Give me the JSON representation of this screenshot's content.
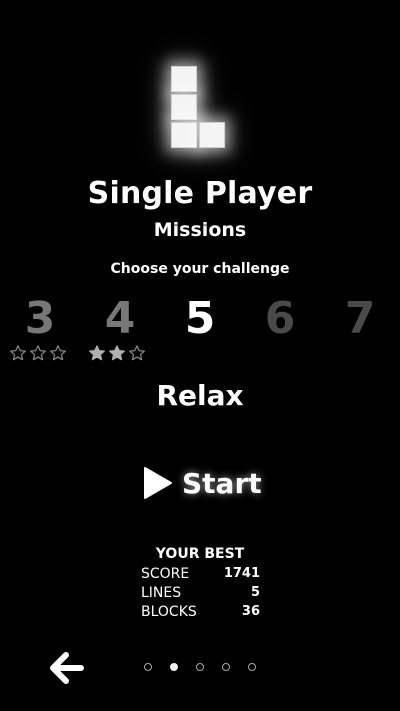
{
  "header": {
    "title": "Single Player",
    "subtitle": "Missions",
    "prompt": "Choose your challenge"
  },
  "levels": [
    {
      "label": "3",
      "state": "dim",
      "stars_earned": 0,
      "stars_total": 3
    },
    {
      "label": "4",
      "state": "dim",
      "stars_earned": 2,
      "stars_total": 3
    },
    {
      "label": "5",
      "state": "selected"
    },
    {
      "label": "6",
      "state": "locked"
    },
    {
      "label": "7",
      "state": "locked"
    }
  ],
  "mode": {
    "label": "Relax"
  },
  "start_button": {
    "label": "Start",
    "icon": "play-icon"
  },
  "best": {
    "title": "YOUR BEST",
    "rows": [
      {
        "label": "SCORE",
        "value": "1741"
      },
      {
        "label": "LINES",
        "value": "5"
      },
      {
        "label": "BLOCKS",
        "value": "36"
      }
    ]
  },
  "navigation": {
    "back_icon": "arrow-left-icon",
    "page_count": 5,
    "current_page": 2
  },
  "colors": {
    "background": "#000000",
    "text": "#ffffff",
    "dim_level": "#777777",
    "locked_level": "#4a4a4a",
    "star_filled": "#b0b0b0",
    "star_empty": "#8a8a8a"
  }
}
